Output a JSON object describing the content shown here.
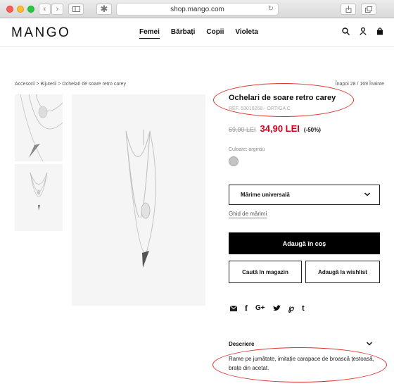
{
  "browser": {
    "url": "shop.mango.com",
    "traffic_lights": {
      "close": "#fc5f57",
      "minimize": "#fdbc2e",
      "zoom": "#28c840"
    }
  },
  "header": {
    "logo": "MANGO",
    "nav": [
      {
        "label": "Femei",
        "active": true
      },
      {
        "label": "Bărbați",
        "active": false
      },
      {
        "label": "Copii",
        "active": false
      },
      {
        "label": "Violeta",
        "active": false
      }
    ],
    "icons": [
      "search-icon",
      "user-icon",
      "bag-icon"
    ]
  },
  "breadcrumb": "Accesorii > Bijuterii > Ochelari de soare retro carey",
  "pager": "Înapoi 28 / 169 Înainte",
  "product": {
    "title": "Ochelari de soare retro carey",
    "ref": "REF. 53010268 - ORTIGA C",
    "old_price": "69,90 LEI",
    "new_price": "34,90 LEI",
    "discount": "(-50%)",
    "color_label": "Culoare: argintiu",
    "color_swatch": "#c4c4c4",
    "size_select": "Mărime universală",
    "size_guide": "Ghid de mărimi",
    "add_to_bag": "Adaugă în coș",
    "find_in_store": "Caută în magazin",
    "add_to_wishlist": "Adaugă la wishlist",
    "share_icons": [
      "mail-icon",
      "facebook-icon",
      "google-plus-icon",
      "twitter-icon",
      "pinterest-icon",
      "tumblr-icon"
    ],
    "description_heading": "Descriere",
    "description_text": "Rame pe jumătate, imitație carapace de broască țestoasă, brațe din acetat."
  },
  "colors": {
    "sale_red": "#d0021b",
    "annotation": "#e0302a",
    "image_bg": "#f5f5f5"
  }
}
